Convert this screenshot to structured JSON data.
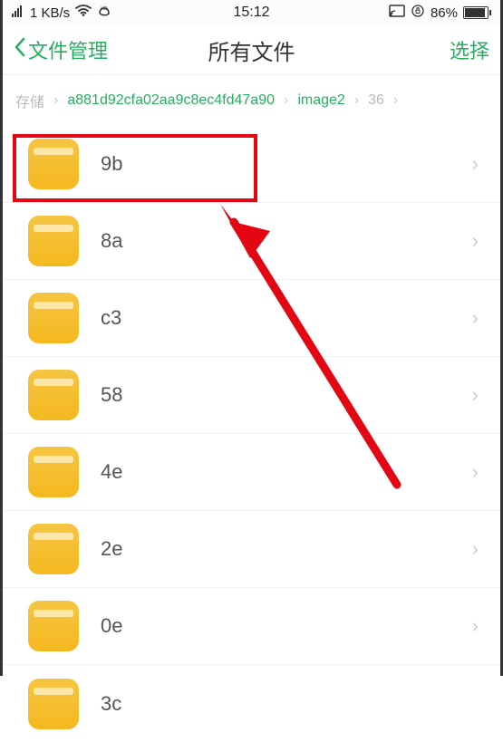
{
  "status": {
    "signal": "⁴ᴳ₊",
    "speed": "1 KB/s",
    "wifi_icon": "wifi",
    "hd_icon": "ᴴᴰ",
    "time": "15:12",
    "cast_icon": "cast",
    "lock_icon": "lock",
    "battery_pct": "86%"
  },
  "nav": {
    "back_label": "文件管理",
    "title": "所有文件",
    "action_label": "选择"
  },
  "breadcrumb": {
    "items": [
      {
        "label": "存储",
        "active": false
      },
      {
        "label": "a881d92cfa02aa9c8ec4fd47a90",
        "active": true
      },
      {
        "label": "image2",
        "active": true
      },
      {
        "label": "36",
        "active": false
      }
    ]
  },
  "files": [
    {
      "name": "9b"
    },
    {
      "name": "8a"
    },
    {
      "name": "c3"
    },
    {
      "name": "58"
    },
    {
      "name": "4e"
    },
    {
      "name": "2e"
    },
    {
      "name": "0e"
    },
    {
      "name": "3c"
    }
  ]
}
